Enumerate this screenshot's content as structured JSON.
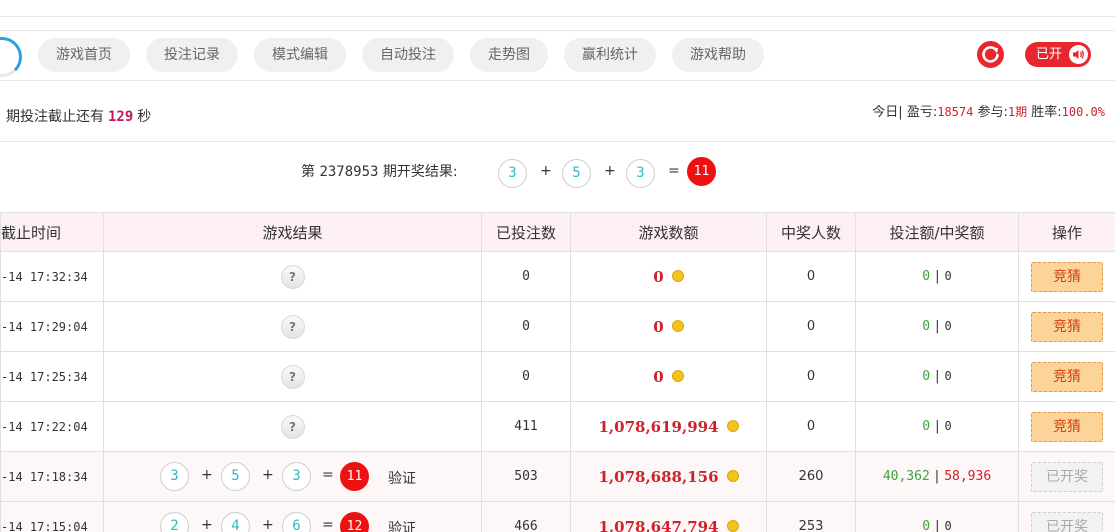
{
  "nav": {
    "items": [
      "游戏首页",
      "投注记录",
      "模式编辑",
      "自动投注",
      "走势图",
      "赢利统计",
      "游戏帮助"
    ],
    "sound_label": "已开"
  },
  "countdown": {
    "prefix": "期投注截止还有",
    "seconds": "129",
    "suffix": "秒"
  },
  "daystats": {
    "today_label": "今日|",
    "profit_label": "盈亏:",
    "profit": "18574",
    "join_label": "参与:",
    "join": "1期",
    "winrate_label": "胜率:",
    "winrate": "100.0%"
  },
  "latest": {
    "prefix": "第",
    "period": "2378953",
    "suffix": "期开奖结果:",
    "balls": [
      "3",
      "5",
      "3"
    ],
    "sum": "11",
    "plus": "+",
    "eq": "="
  },
  "table": {
    "headers": [
      "截止时间",
      "游戏结果",
      "已投注数",
      "游戏数额",
      "中奖人数",
      "投注额/中奖额",
      "操作"
    ],
    "verify_label": "验证",
    "guess_label": "竞猜",
    "done_label": "已开奖",
    "rows": [
      {
        "time": "-14 17:32:34",
        "count": "0",
        "amount": "0",
        "winners": "0",
        "bet": "0",
        "win": "0"
      },
      {
        "time": "-14 17:29:04",
        "count": "0",
        "amount": "0",
        "winners": "0",
        "bet": "0",
        "win": "0"
      },
      {
        "time": "-14 17:25:34",
        "count": "0",
        "amount": "0",
        "winners": "0",
        "bet": "0",
        "win": "0"
      },
      {
        "time": "-14 17:22:04",
        "count": "411",
        "amount": "1,078,619,994",
        "winners": "0",
        "bet": "0",
        "win": "0"
      },
      {
        "time": "-14 17:18:34",
        "balls": [
          "3",
          "5",
          "3"
        ],
        "sum": "11",
        "count": "503",
        "amount": "1,078,688,156",
        "winners": "260",
        "bet": "40,362",
        "win": "58,936"
      },
      {
        "time": "-14 17:15:04",
        "balls": [
          "2",
          "4",
          "6"
        ],
        "sum": "12",
        "count": "466",
        "amount": "1,078,647,794",
        "winners": "253",
        "bet": "0",
        "win": "0"
      }
    ]
  }
}
